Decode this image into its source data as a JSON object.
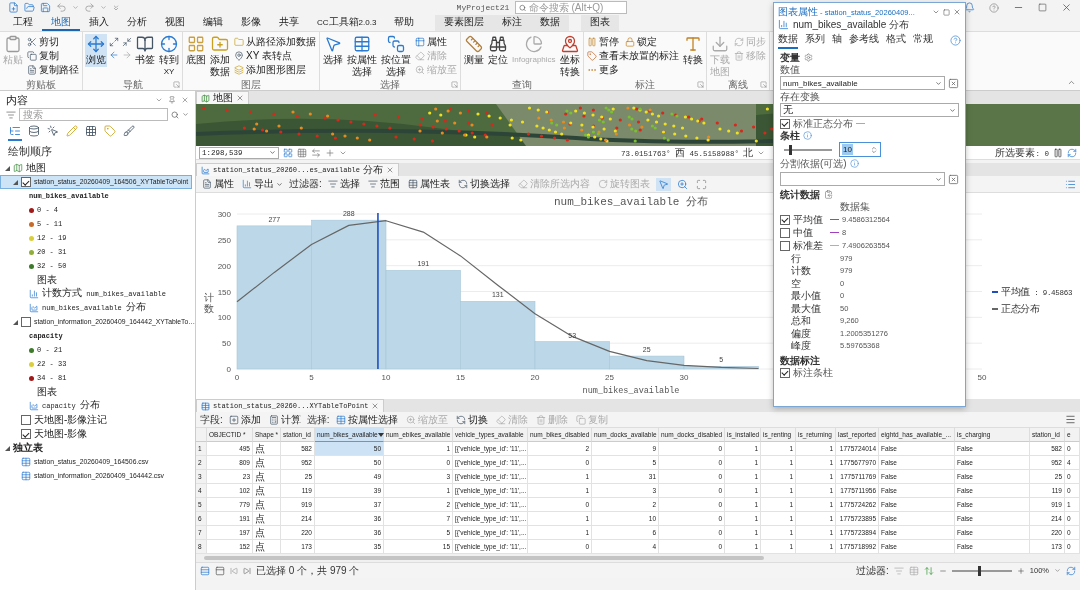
{
  "title_bar": {
    "project": "MyProject21",
    "search": {
      "placeholder": "命令搜索 (Alt+Q)"
    }
  },
  "ribbon_tabs": [
    {
      "label": "工程",
      "kind": "main",
      "selected": false
    },
    {
      "label": "地图",
      "kind": "main",
      "selected": true
    },
    {
      "label": "插入",
      "kind": "main",
      "selected": false
    },
    {
      "label": "分析",
      "kind": "main",
      "selected": false
    },
    {
      "label": "视图",
      "kind": "main",
      "selected": false
    },
    {
      "label": "编辑",
      "kind": "main",
      "selected": false
    },
    {
      "label": "影像",
      "kind": "main",
      "selected": false
    },
    {
      "label": "共享",
      "kind": "main",
      "selected": false
    },
    {
      "label": "CC工具箱2.0.3",
      "kind": "main",
      "selected": false
    },
    {
      "label": "帮助",
      "kind": "main",
      "selected": false
    },
    {
      "label": "要素图层",
      "kind": "layer",
      "selected": false
    },
    {
      "label": "标注",
      "kind": "layer",
      "selected": false
    },
    {
      "label": "数据",
      "kind": "layer",
      "selected": false
    },
    {
      "label": "图表",
      "kind": "chart",
      "selected": false
    }
  ],
  "ribbon": {
    "groups": [
      {
        "label": "剪贴板",
        "launcher": false,
        "items": [
          {
            "kind": "large",
            "label": "粘贴",
            "disabled": true,
            "selected": false
          },
          {
            "kind": "stack",
            "rows": [
              [
                {
                  "label": "剪切",
                  "disabled": false
                }
              ],
              [
                {
                  "label": "复制",
                  "disabled": false
                }
              ],
              [
                {
                  "label": "复制路径",
                  "disabled": false
                }
              ]
            ]
          }
        ]
      },
      {
        "label": "导航",
        "launcher": true,
        "items": [
          {
            "kind": "large",
            "label": "浏览",
            "disabled": false,
            "selected": true
          },
          {
            "kind": "icon_grid"
          },
          {
            "kind": "large",
            "label": "书签",
            "disabled": false,
            "selected": false
          },
          {
            "kind": "large",
            "label": "转到XY",
            "disabled": false,
            "selected": false
          }
        ]
      },
      {
        "label": "图层",
        "launcher": false,
        "items": [
          {
            "kind": "large",
            "label": "底图",
            "disabled": false,
            "selected": false
          },
          {
            "kind": "large",
            "label": "添加数据",
            "disabled": false,
            "selected": false
          },
          {
            "kind": "stack",
            "rows": [
              [
                {
                  "label": "从路径添加数据",
                  "disabled": false
                }
              ],
              [
                {
                  "label": "XY 表转点",
                  "disabled": false
                }
              ],
              [
                {
                  "label": "添加图形图层",
                  "disabled": false
                }
              ]
            ]
          }
        ]
      },
      {
        "label": "选择",
        "launcher": true,
        "items": [
          {
            "kind": "large",
            "label": "选择",
            "disabled": false,
            "selected": false
          },
          {
            "kind": "large",
            "label": "按属性选择",
            "disabled": false,
            "selected": false
          },
          {
            "kind": "large",
            "label": "按位置选择",
            "disabled": false,
            "selected": false
          },
          {
            "kind": "stack",
            "rows": [
              [
                {
                  "label": "属性",
                  "disabled": false
                }
              ],
              [
                {
                  "label": "清除",
                  "disabled": true
                }
              ],
              [
                {
                  "label": "缩放至",
                  "disabled": true
                }
              ]
            ]
          }
        ]
      },
      {
        "label": "查询",
        "launcher": false,
        "items": [
          {
            "kind": "large",
            "label": "测量",
            "disabled": false,
            "selected": false
          },
          {
            "kind": "large",
            "label": "定位",
            "disabled": false,
            "selected": false
          },
          {
            "kind": "large",
            "label": "Infographics",
            "disabled": true,
            "selected": false
          },
          {
            "kind": "large",
            "label": "坐标转换",
            "disabled": false,
            "selected": false
          }
        ]
      },
      {
        "label": "标注",
        "launcher": true,
        "items": [
          {
            "kind": "stack",
            "rows": [
              [
                {
                  "label": "暂停",
                  "disabled": false
                },
                {
                  "label": "锁定",
                  "disabled": false
                }
              ],
              [
                {
                  "label": "查看未放置的标注",
                  "disabled": false
                }
              ],
              [
                {
                  "label": "更多",
                  "disabled": false
                }
              ]
            ]
          },
          {
            "kind": "large",
            "label": "转换",
            "disabled": false,
            "selected": false
          }
        ]
      },
      {
        "label": "离线",
        "launcher": true,
        "items": [
          {
            "kind": "large",
            "label": "下载地图",
            "disabled": true,
            "selected": false
          },
          {
            "kind": "stack",
            "rows": [
              [
                {
                  "label": "同步",
                  "disabled": true
                }
              ],
              [
                {
                  "label": "移除",
                  "disabled": true
                }
              ]
            ]
          }
        ]
      }
    ]
  },
  "contents_pane": {
    "title": "内容",
    "search": {
      "placeholder": "搜索"
    },
    "view_tabs": [
      {
        "selected": true
      },
      {
        "selected": false
      },
      {
        "selected": false
      },
      {
        "selected": false
      },
      {
        "selected": false
      },
      {
        "selected": false
      },
      {
        "selected": false
      }
    ],
    "section": "绘制顺序",
    "tree": [
      {
        "kind": "map",
        "label": "地图",
        "expanded": true,
        "children": [
          {
            "kind": "layer",
            "label": "station_status_20260409_164506_XYTableToPoint",
            "checked": true,
            "selected": true,
            "expanded": true,
            "children": [
              {
                "kind": "legend_heading",
                "label": "num_bikes_available"
              },
              {
                "kind": "class",
                "label": "0 - 4",
                "color": "#a01818"
              },
              {
                "kind": "class",
                "label": "5 - 11",
                "color": "#c86a28"
              },
              {
                "kind": "class",
                "label": "12 - 19",
                "color": "#d8cf3a"
              },
              {
                "kind": "class",
                "label": "20 - 31",
                "color": "#8fae3a"
              },
              {
                "kind": "class",
                "label": "32 - 50",
                "color": "#3d7a2a"
              },
              {
                "kind": "heading",
                "label": "图表"
              },
              {
                "kind": "bar_chart",
                "label": "计数方式 num_bikes_available"
              },
              {
                "kind": "histogram",
                "label": "num_bikes_available 分布"
              }
            ]
          },
          {
            "kind": "layer",
            "label": "station_information_20260409_164442_XYTableTo…",
            "checked": false,
            "selected": false,
            "expanded": true,
            "children": [
              {
                "kind": "legend_heading",
                "label": "capacity"
              },
              {
                "kind": "class",
                "label": "0 - 21",
                "color": "#3d7a2a"
              },
              {
                "kind": "class",
                "label": "22 - 33",
                "color": "#d8cf3a"
              },
              {
                "kind": "class",
                "label": "34 - 81",
                "color": "#a01818"
              },
              {
                "kind": "heading",
                "label": "图表"
              },
              {
                "kind": "histogram",
                "label": "capacity 分布"
              }
            ]
          },
          {
            "kind": "basemap",
            "label": "天地图-影像注记",
            "checked": false,
            "selected": false
          },
          {
            "kind": "basemap",
            "label": "天地图-影像",
            "checked": true,
            "selected": false
          }
        ]
      },
      {
        "kind": "group",
        "label": "独立表",
        "expanded": true,
        "children": [
          {
            "kind": "table",
            "label": "station_status_20260409_164506.csv"
          },
          {
            "kind": "table",
            "label": "station_information_20260409_164442.csv"
          }
        ]
      }
    ]
  },
  "map_view": {
    "tab": "地图",
    "scale": "1:298,539",
    "coordinates": "73.0151763° 西 45.5158988° 北",
    "selected_features": "所选要素: 0"
  },
  "chart_view": {
    "tab": "station_status_20260...es_available 分布",
    "toolbar": [
      {
        "kind": "button",
        "label": "属性",
        "disabled": false
      },
      {
        "kind": "dropdown",
        "label": "导出",
        "disabled": false
      },
      {
        "kind": "label",
        "label": "过滤器:"
      },
      {
        "kind": "button",
        "label": "选择",
        "disabled": false
      },
      {
        "kind": "button",
        "label": "范围",
        "disabled": false
      },
      {
        "kind": "button",
        "label": "属性表",
        "disabled": false
      },
      {
        "kind": "button",
        "label": "切换选择",
        "disabled": false
      },
      {
        "kind": "button",
        "label": "清除所选内容",
        "disabled": true
      },
      {
        "kind": "button",
        "label": "旋转图表",
        "disabled": true
      },
      {
        "kind": "tool",
        "selected": true
      },
      {
        "kind": "tool",
        "selected": false
      },
      {
        "kind": "tool",
        "selected": false
      }
    ],
    "chart_data": {
      "type": "bar",
      "title": "num_bikes_available 分布",
      "xlabel": "num_bikes_available",
      "ylabel": "计数",
      "x": [
        2.5,
        7.5,
        12.5,
        17.5,
        22.5,
        27.5,
        32.5
      ],
      "series": [
        {
          "color": "#bcd8e8",
          "values": [
            277,
            288,
            191,
            131,
            53,
            25,
            5
          ]
        },
        {
          "name": "正态分布",
          "type": "line",
          "color": "#666666",
          "x": [
            0,
            2.5,
            5,
            7.5,
            10,
            12.5,
            15,
            17.5,
            20,
            22.5,
            25,
            27.5,
            30,
            32.5,
            35
          ],
          "values": [
            130,
            187,
            241,
            278,
            287,
            265,
            219,
            162,
            107,
            63,
            34,
            16,
            7,
            3,
            1
          ]
        }
      ],
      "xlim": [
        0,
        50
      ],
      "ylim": [
        0,
        300
      ],
      "xticks": [
        0,
        5,
        10,
        15,
        20,
        25,
        30,
        50
      ],
      "yticks": [
        0,
        50,
        100,
        150,
        200,
        250,
        300
      ],
      "value_labels": [
        "277",
        "288",
        "191",
        "131",
        "53",
        "25",
        "5"
      ],
      "grid": true,
      "ref_lines": [
        {
          "axis": "x",
          "value": 9.4586,
          "color": "#1f4fbf"
        }
      ]
    },
    "legend": [
      {
        "label": "平均值 : 9.45863",
        "color": "#1f4fbf"
      }
    ]
  },
  "table_view": {
    "tab": "station_status_20260...XYTableToPoint",
    "toolbar": [
      {
        "kind": "label",
        "label": "字段:"
      },
      {
        "kind": "button",
        "label": "添加",
        "disabled": false
      },
      {
        "kind": "button",
        "label": "计算",
        "disabled": false
      },
      {
        "kind": "label",
        "label": "选择:"
      },
      {
        "kind": "button",
        "label": "按属性选择",
        "disabled": false
      },
      {
        "kind": "button",
        "label": "缩放至",
        "disabled": true
      },
      {
        "kind": "button",
        "label": "切换",
        "disabled": false
      },
      {
        "kind": "button",
        "label": "清除",
        "disabled": true
      },
      {
        "kind": "button",
        "label": "删除",
        "disabled": true
      },
      {
        "kind": "button",
        "label": "复制",
        "disabled": true
      }
    ],
    "columns": [
      {
        "label": "OBJECTID *",
        "kind": "number",
        "selected": false,
        "sorted": false
      },
      {
        "label": "Shape *",
        "kind": "shape",
        "selected": false,
        "sorted": false
      },
      {
        "label": "station_id",
        "kind": "number",
        "selected": false,
        "sorted": false
      },
      {
        "label": "num_bikes_available",
        "kind": "number",
        "selected": true,
        "sorted": true
      },
      {
        "label": "num_ebikes_available",
        "kind": "number",
        "selected": false,
        "sorted": false
      },
      {
        "label": "vehicle_types_available",
        "kind": "text",
        "selected": false,
        "sorted": false
      },
      {
        "label": "num_bikes_disabled",
        "kind": "number",
        "selected": false,
        "sorted": false
      },
      {
        "label": "num_docks_available",
        "kind": "number",
        "selected": false,
        "sorted": false
      },
      {
        "label": "num_docks_disabled",
        "kind": "number",
        "selected": false,
        "sorted": false
      },
      {
        "label": "is_installed",
        "kind": "number",
        "selected": false,
        "sorted": false
      },
      {
        "label": "is_renting",
        "kind": "number",
        "selected": false,
        "sorted": false
      },
      {
        "label": "is_returning",
        "kind": "number",
        "selected": false,
        "sorted": false
      },
      {
        "label": "last_reported",
        "kind": "number",
        "selected": false,
        "sorted": false
      },
      {
        "label": "eightd_has_available_...",
        "kind": "text",
        "selected": false,
        "sorted": false
      },
      {
        "label": "is_charging",
        "kind": "text",
        "selected": false,
        "sorted": false
      },
      {
        "label": "station_id",
        "kind": "number",
        "selected": false,
        "sorted": false
      },
      {
        "label": "e",
        "kind": "text",
        "selected": false,
        "sorted": false
      }
    ],
    "rows": [
      {
        "number": "1",
        "current": true,
        "cells": [
          "495",
          "点",
          "582",
          "50",
          "1",
          "[{'vehicle_type_id': '11',...",
          "2",
          "9",
          "0",
          "1",
          "1",
          "1",
          "1775724014",
          "False",
          "False",
          "582",
          "0"
        ]
      },
      {
        "number": "2",
        "current": false,
        "cells": [
          "809",
          "点",
          "952",
          "50",
          "0",
          "[{'vehicle_type_id': '11',...",
          "0",
          "5",
          "0",
          "1",
          "1",
          "1",
          "1775677970",
          "False",
          "False",
          "952",
          "4"
        ]
      },
      {
        "number": "3",
        "current": false,
        "cells": [
          "23",
          "点",
          "25",
          "49",
          "3",
          "[{'vehicle_type_id': '11',...",
          "1",
          "31",
          "0",
          "1",
          "1",
          "1",
          "1775711769",
          "False",
          "False",
          "25",
          "0"
        ]
      },
      {
        "number": "4",
        "current": false,
        "cells": [
          "102",
          "点",
          "119",
          "39",
          "1",
          "[{'vehicle_type_id': '11',...",
          "1",
          "3",
          "0",
          "1",
          "1",
          "1",
          "1775711956",
          "False",
          "False",
          "119",
          "0"
        ]
      },
      {
        "number": "5",
        "current": false,
        "cells": [
          "779",
          "点",
          "919",
          "37",
          "2",
          "[{'vehicle_type_id': '11',...",
          "0",
          "2",
          "0",
          "1",
          "1",
          "1",
          "1775724262",
          "False",
          "False",
          "919",
          "1"
        ]
      },
      {
        "number": "6",
        "current": false,
        "cells": [
          "191",
          "点",
          "214",
          "36",
          "7",
          "[{'vehicle_type_id': '11',...",
          "1",
          "10",
          "0",
          "1",
          "1",
          "1",
          "1775723895",
          "False",
          "False",
          "214",
          "0"
        ]
      },
      {
        "number": "7",
        "current": false,
        "cells": [
          "197",
          "点",
          "220",
          "36",
          "5",
          "[{'vehicle_type_id': '11',...",
          "1",
          "6",
          "0",
          "1",
          "1",
          "1",
          "1775723894",
          "False",
          "False",
          "220",
          "0"
        ]
      },
      {
        "number": "8",
        "current": false,
        "cells": [
          "152",
          "点",
          "173",
          "35",
          "15",
          "[{'vehicle_type_id': '11',...",
          "0",
          "4",
          "0",
          "1",
          "1",
          "1",
          "1775718992",
          "False",
          "False",
          "173",
          "0"
        ]
      }
    ],
    "footer": {
      "selection": "已选择 0 个，共 979 个",
      "filter_label": "过滤器:",
      "zoom": {
        "level": 0.45,
        "reading": "100%"
      }
    }
  },
  "chart_properties": {
    "title": "图表属性 - station_status_20260409...",
    "subtitle": "num_bikes_available 分布",
    "tabs": [
      {
        "label": "数据",
        "selected": true
      },
      {
        "label": "系列",
        "selected": false
      },
      {
        "label": "轴",
        "selected": false
      },
      {
        "label": "参考线",
        "selected": false
      },
      {
        "label": "格式",
        "selected": false
      },
      {
        "label": "常规",
        "selected": false
      }
    ],
    "variable_heading": "变量",
    "numeric_label": "数值",
    "numeric_field": "num_bikes_available",
    "transform_label": "存在变换",
    "transform_value": "无",
    "normal_dist": {
      "label": "标准正态分布",
      "checked": true
    },
    "bins_label": "条柱",
    "bins": {
      "level": 0.1,
      "value": "10"
    },
    "split_label": "分割依据(可选)",
    "stats_heading": "统计数据",
    "stats_column": "数据集",
    "stats": [
      {
        "kind": "toggle",
        "label": "平均值",
        "checked": true,
        "color": "#e03a3a",
        "value": "9.4586312564"
      },
      {
        "kind": "toggle",
        "label": "中值",
        "checked": false,
        "color": "#a040c0",
        "value": "8"
      },
      {
        "kind": "toggle",
        "label": "标准差",
        "checked": false,
        "color": "#b0b0b0",
        "value": "7.4906263554"
      },
      {
        "kind": "plain",
        "label": "行",
        "value": "979"
      },
      {
        "kind": "plain",
        "label": "计数",
        "value": "979"
      },
      {
        "kind": "plain",
        "label": "空",
        "value": "0"
      },
      {
        "kind": "plain",
        "label": "最小值",
        "value": "0"
      },
      {
        "kind": "plain",
        "label": "最大值",
        "value": "50"
      },
      {
        "kind": "plain",
        "label": "总和",
        "value": "9,260"
      },
      {
        "kind": "plain",
        "label": "偏度",
        "value": "1.2005351276"
      },
      {
        "kind": "plain",
        "label": "峰度",
        "value": "5.59765368"
      }
    ],
    "labels_heading": "数据标注",
    "label_bins": {
      "label": "标注条柱",
      "checked": true
    }
  }
}
